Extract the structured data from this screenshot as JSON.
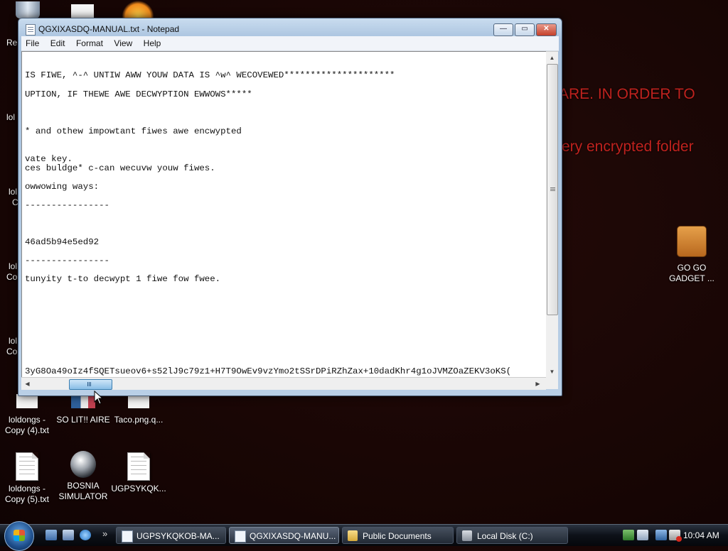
{
  "desktop": {
    "wallpaper_text_1": "ARE. IN ORDER TO",
    "wallpaper_text_2": "ery encrypted folder",
    "left_labels": [
      "Re",
      "lol",
      "lol",
      "C",
      "lol",
      "Co",
      "lol",
      "Co"
    ],
    "icons": [
      {
        "label": "loldongs -\nCopy (4).txt"
      },
      {
        "label": "SO LIT!! AIRE"
      },
      {
        "label": "Taco.png.q..."
      },
      {
        "label": "loldongs -\nCopy (5).txt"
      },
      {
        "label": "BOSNIA\nSIMULATOR"
      },
      {
        "label": "UGPSYKQK..."
      },
      {
        "label": "GO GO\nGADGET ..."
      }
    ]
  },
  "window": {
    "title": "QGXIXASDQ-MANUAL.txt - Notepad",
    "controls": {
      "minimize": "—",
      "maximize": "▭",
      "close": "✕"
    },
    "menu": [
      "File",
      "Edit",
      "Format",
      "View",
      "Help"
    ],
    "lines": [
      "IS FIWE, ^-^ UNTIW AWW YOUW DATA IS ^w^ WECOVEWED*********************",
      "UPTION, IF THEWE AWE DECWYPTION EWWOWS*****",
      "* and othew impowtant fiwes awe encwypted",
      "vate key.",
      "ces buldge* c-can wecuvw youw fiwes.",
      "owwowing ways:",
      "----------------",
      "46ad5b94e5ed92",
      "----------------",
      "tunyity t-to decwypt 1 fiwe fow fwee.",
      "3yG8Oa49oIz4fSQETsueov6+s52lJ9c79z1+H7T9OwEv9vzYmo2tSSrDPiRZhZax+10dadKhr4g1oJVMZOaZEKV3oKS("
    ],
    "scroll": {
      "v_up": "▲",
      "v_down": "▼",
      "h_left": "◀",
      "h_right": "▶"
    }
  },
  "taskbar": {
    "buttons": [
      {
        "label": "UGPSYKQKOB-MA..."
      },
      {
        "label": "QGXIXASDQ-MANU..."
      },
      {
        "label": "Public Documents"
      },
      {
        "label": "Local Disk (C:)"
      }
    ],
    "overflow": "»",
    "time": "10:04 AM"
  }
}
